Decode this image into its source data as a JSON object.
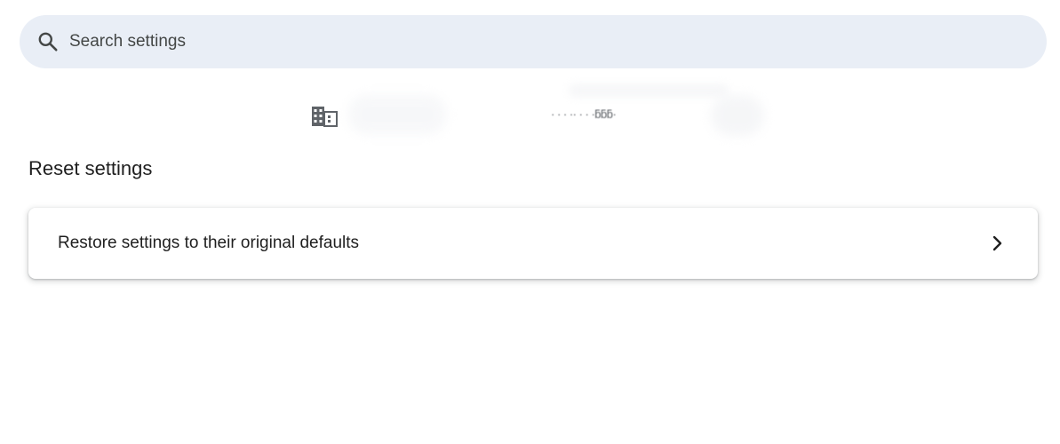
{
  "search": {
    "placeholder": "Search settings",
    "value": ""
  },
  "managed_notice": {
    "icon": "building-icon",
    "text": "· · · ·· · · ·ƃƃƃ·"
  },
  "reset_section": {
    "title": "Reset settings",
    "items": [
      {
        "label": "Restore settings to their original defaults",
        "icon": "chevron-right-icon"
      }
    ]
  }
}
